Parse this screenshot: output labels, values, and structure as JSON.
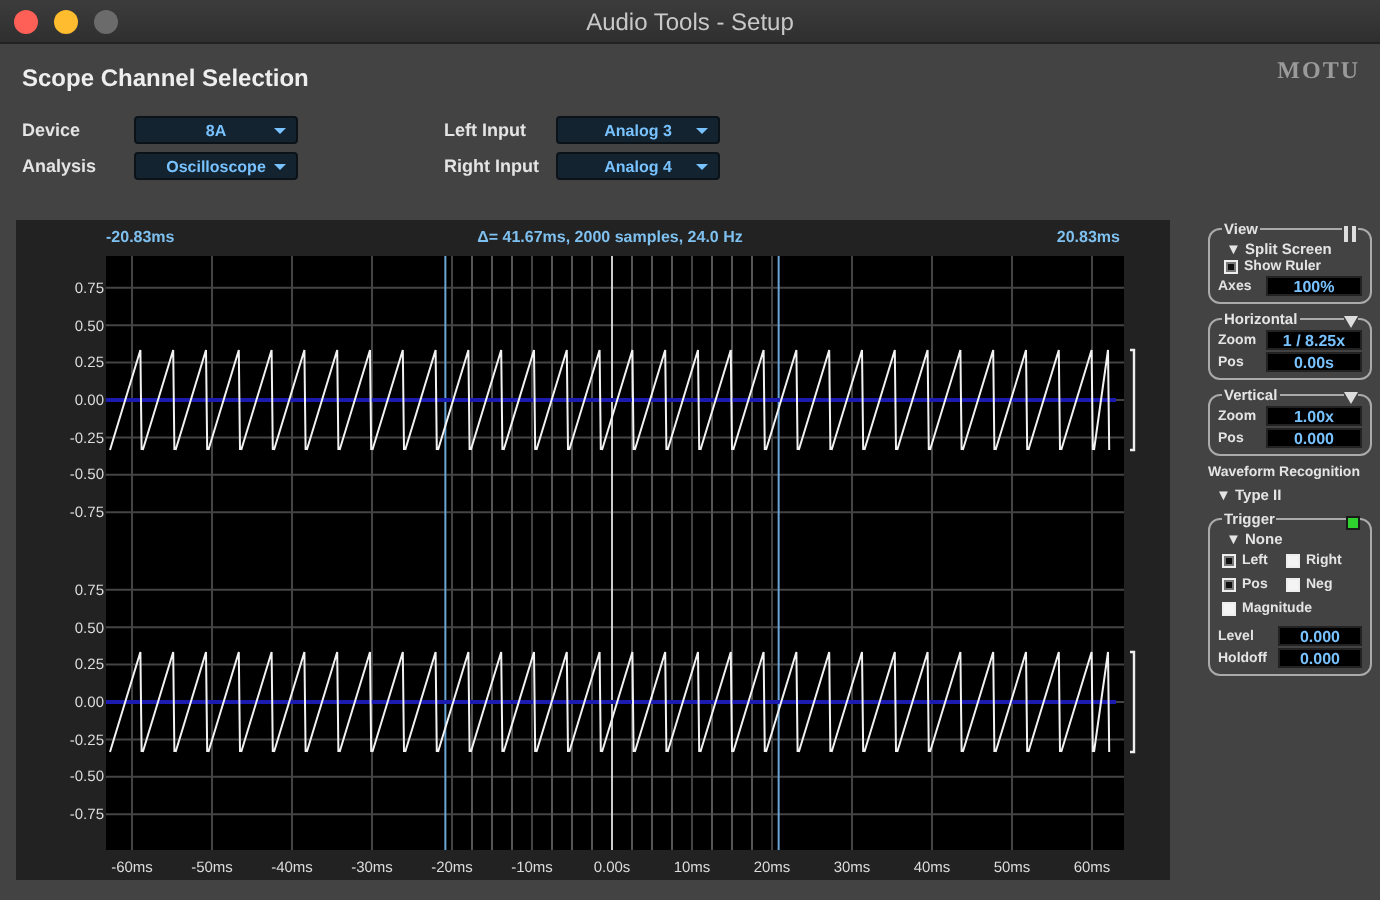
{
  "window": {
    "title": "Audio Tools - Setup"
  },
  "header": {
    "title": "Scope Channel Selection",
    "logo": "MOTU"
  },
  "selectors": [
    {
      "label": "Device",
      "value": "8A"
    },
    {
      "label": "Analysis",
      "value": "Oscilloscope"
    },
    {
      "label": "Left Input",
      "value": "Analog 3"
    },
    {
      "label": "Right Input",
      "value": "Analog 4"
    }
  ],
  "scope": {
    "cursor_left": "-20.83ms",
    "info": "Δ= 41.67ms, 2000 samples, 24.0 Hz",
    "cursor_right": "20.83ms",
    "channels": [
      {
        "y_ticks": [
          "0.75",
          "0.50",
          "0.25",
          "0.00",
          "-0.25",
          "-0.50",
          "-0.75"
        ]
      },
      {
        "y_ticks": [
          "0.75",
          "0.50",
          "0.25",
          "0.00",
          "-0.25",
          "-0.50",
          "-0.75"
        ]
      }
    ],
    "x_ticks": [
      "-60ms",
      "-50ms",
      "-40ms",
      "-30ms",
      "-20ms",
      "-10ms",
      "0.00s",
      "10ms",
      "20ms",
      "30ms",
      "40ms",
      "50ms",
      "60ms"
    ]
  },
  "panel": {
    "view": {
      "title": "View",
      "split": "▼ Split Screen",
      "show_ruler": {
        "label": "Show Ruler",
        "checked": true
      },
      "axes": {
        "label": "Axes",
        "value": "100%"
      }
    },
    "horizontal": {
      "title": "Horizontal",
      "rows": [
        {
          "label": "Zoom",
          "value": "1 / 8.25x"
        },
        {
          "label": "Pos",
          "value": "0.00s"
        }
      ]
    },
    "vertical": {
      "title": "Vertical",
      "rows": [
        {
          "label": "Zoom",
          "value": "1.00x"
        },
        {
          "label": "Pos",
          "value": "0.000"
        }
      ]
    },
    "waveform": {
      "title": "Waveform Recognition",
      "mode": "▼ Type II"
    },
    "trigger": {
      "title": "Trigger",
      "on": true,
      "mode": "▼ None",
      "options": [
        {
          "label": "Left",
          "checked": true
        },
        {
          "label": "Right",
          "checked": false
        },
        {
          "label": "Pos",
          "checked": true
        },
        {
          "label": "Neg",
          "checked": false
        },
        {
          "label": "Magnitude",
          "checked": false
        }
      ],
      "fields": [
        {
          "label": "Level",
          "value": "0.000"
        },
        {
          "label": "Holdoff",
          "value": "0.000"
        }
      ]
    }
  }
}
